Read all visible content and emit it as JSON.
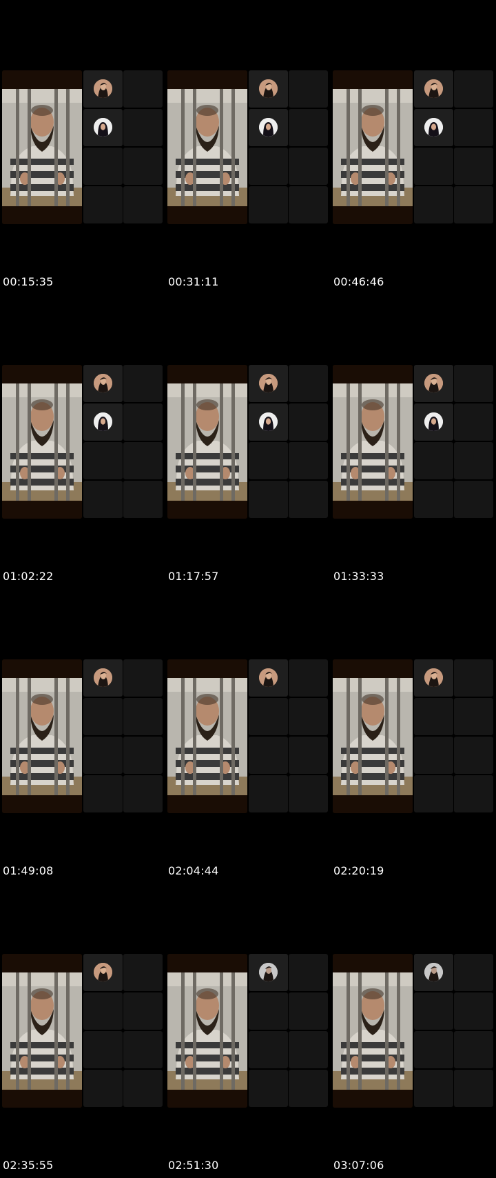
{
  "contact_sheet": {
    "frames": [
      {
        "timestamp": "00:15:35",
        "avatars": [
          "a1",
          "a2"
        ]
      },
      {
        "timestamp": "00:31:11",
        "avatars": [
          "a1",
          "a2"
        ]
      },
      {
        "timestamp": "00:46:46",
        "avatars": [
          "a1",
          "a2"
        ]
      },
      {
        "timestamp": "01:02:22",
        "avatars": [
          "a1",
          "a2"
        ]
      },
      {
        "timestamp": "01:17:57",
        "avatars": [
          "a1",
          "a2"
        ]
      },
      {
        "timestamp": "01:33:33",
        "avatars": [
          "a1",
          "a2"
        ]
      },
      {
        "timestamp": "01:49:08",
        "avatars": [
          "a1"
        ]
      },
      {
        "timestamp": "02:04:44",
        "avatars": [
          "a1"
        ]
      },
      {
        "timestamp": "02:20:19",
        "avatars": [
          "a1"
        ]
      },
      {
        "timestamp": "02:35:55",
        "avatars": [
          "a1"
        ]
      },
      {
        "timestamp": "02:51:30",
        "avatars": [
          "a3"
        ]
      },
      {
        "timestamp": "03:07:06",
        "avatars": [
          "a3"
        ]
      }
    ],
    "colors": {
      "background": "#000000",
      "tile": "#161616",
      "tile_active": "#1f1f1f",
      "portrait_frame": "#1a0d05",
      "timestamp_text": "#ffffff"
    },
    "icons": {
      "portrait": "prisoner-behind-bars-image",
      "avatar_1": "participant-avatar-woman-dark-hair",
      "avatar_2": "participant-avatar-woman-hijab",
      "avatar_3": "participant-avatar-woman-grey"
    }
  }
}
